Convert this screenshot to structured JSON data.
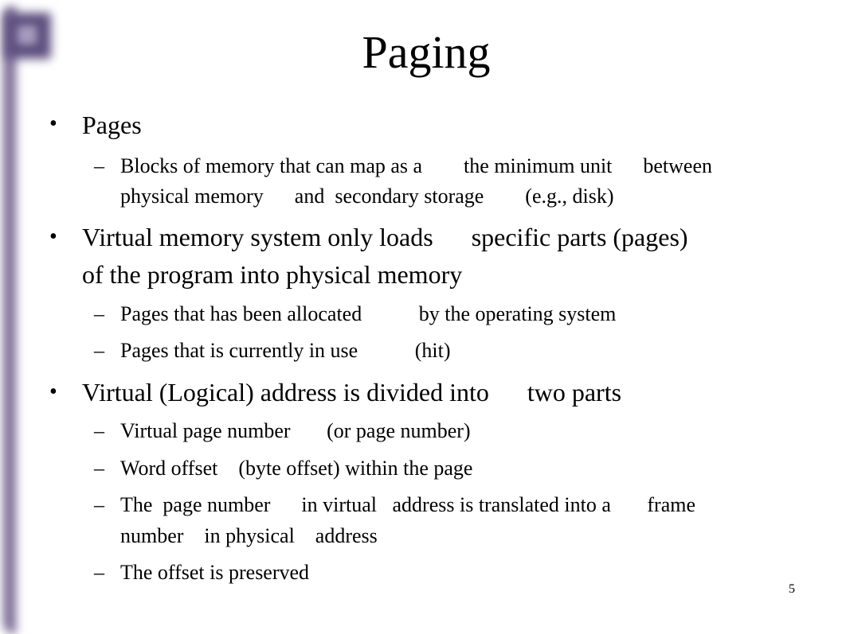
{
  "slide": {
    "title": "Paging",
    "page_number": "5",
    "bullet_char": "•",
    "dash_char": "–",
    "items": [
      {
        "text": "Pages",
        "children": [
          {
            "lines": [
              "Blocks of memory that can map as a        the minimum unit      between",
              "physical memory      and  secondary storage        (e.g., disk)"
            ]
          }
        ]
      },
      {
        "lines": [
          "Virtual memory system only loads      specific parts (pages)",
          "of the program into physical memory"
        ],
        "children": [
          {
            "lines": [
              "Pages that has been allocated           by the operating system"
            ]
          },
          {
            "lines": [
              "Pages that is currently in use           (hit)"
            ]
          }
        ]
      },
      {
        "text": "Virtual (Logical) address is divided into      two parts",
        "children": [
          {
            "lines": [
              "Virtual page number       (or page number)"
            ]
          },
          {
            "lines": [
              "Word offset    (byte offset) within the page"
            ]
          },
          {
            "lines": [
              "The  page number      in virtual   address is translated into a       frame",
              "number    in physical    address"
            ]
          },
          {
            "lines": [
              "The offset is preserved"
            ]
          }
        ]
      }
    ]
  },
  "decoration": {
    "accent_color": "#5e4f80",
    "bar_color": "#7a6b94"
  }
}
